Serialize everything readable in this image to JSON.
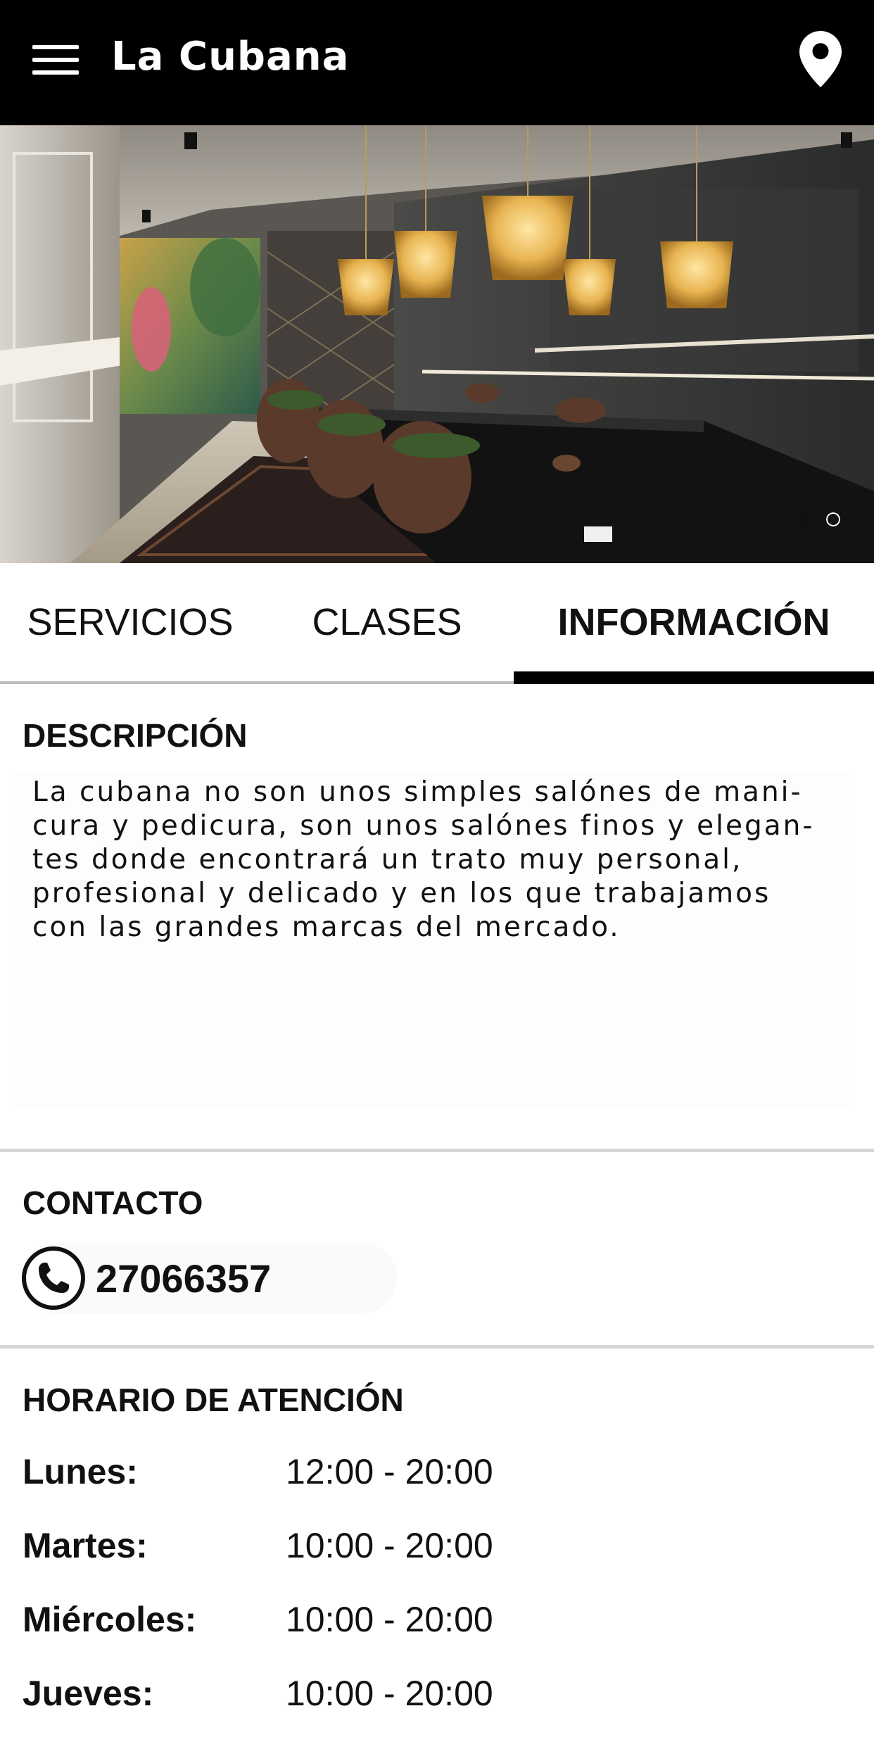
{
  "appbar": {
    "title": "La Cubana",
    "menu_icon": "hamburger-menu-icon",
    "location_icon": "map-pin-icon"
  },
  "carousel": {
    "image": "restaurant-salon-interior-photo",
    "slide_count": 2,
    "active_index": 0
  },
  "tabs": [
    {
      "label": "SERVICIOS",
      "selected": false
    },
    {
      "label": "CLASES",
      "selected": false
    },
    {
      "label": "INFORMACIÓN",
      "selected": true
    }
  ],
  "description": {
    "title": "DESCRIPCIÓN",
    "line1": "La cubana no son unos simples salónes de mani-",
    "line2": "cura y pedicura, son unos salónes finos y elegan-",
    "line3": "tes donde encontrará un trato muy personal,",
    "line4": "profesional y delicado y en los que trabajamos",
    "line5": "con las grandes marcas del mercado."
  },
  "contact": {
    "title": "CONTACTO",
    "icon": "phone-icon",
    "phone": "27066357"
  },
  "hours": {
    "title": "HORARIO DE ATENCIÓN",
    "rows": [
      {
        "day": "Lunes:",
        "time": "12:00 - 20:00"
      },
      {
        "day": "Martes:",
        "time": "10:00 - 20:00"
      },
      {
        "day": "Miércoles:",
        "time": "10:00 - 20:00"
      },
      {
        "day": "Jueves:",
        "time": "10:00 - 20:00"
      }
    ]
  },
  "colors": {
    "appbar": "#000000",
    "tab_indicator": "#000000",
    "divider": "#d6d6d6"
  }
}
